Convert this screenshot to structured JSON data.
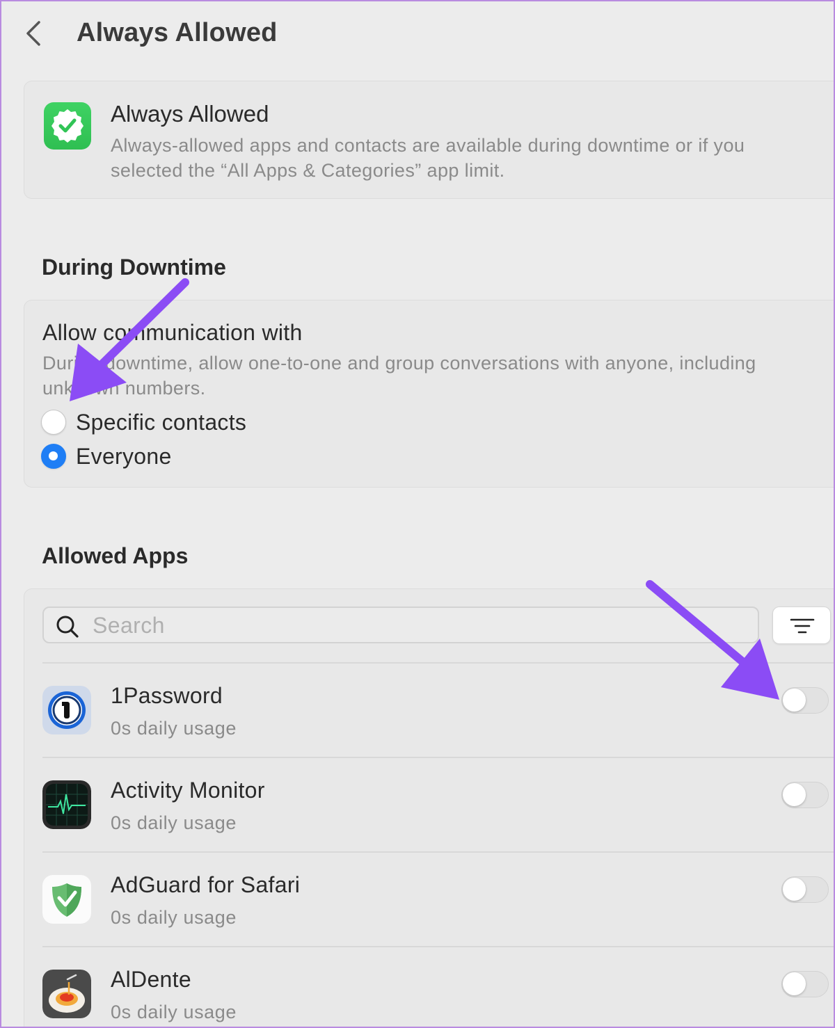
{
  "header": {
    "title": "Always Allowed",
    "back_icon": "chevron-left-icon"
  },
  "info": {
    "icon": "checkmark-seal-icon",
    "title": "Always Allowed",
    "description": "Always-allowed apps and contacts are available during downtime or if you selected the “All Apps & Categories” app limit."
  },
  "downtime": {
    "section_title": "During Downtime",
    "title": "Allow communication with",
    "description": "During downtime, allow one-to-one and group conversations with anyone, including unknown numbers.",
    "options": [
      {
        "label": "Specific contacts",
        "checked": false
      },
      {
        "label": "Everyone",
        "checked": true
      }
    ]
  },
  "apps": {
    "section_title": "Allowed Apps",
    "search_placeholder": "Search",
    "filter_icon": "filter-lines-icon",
    "items": [
      {
        "name": "1Password",
        "usage": "0s daily usage",
        "enabled": false,
        "icon": "1password-icon"
      },
      {
        "name": "Activity Monitor",
        "usage": "0s daily usage",
        "enabled": false,
        "icon": "activity-monitor-icon"
      },
      {
        "name": "AdGuard for Safari",
        "usage": "0s daily usage",
        "enabled": false,
        "icon": "adguard-shield-icon"
      },
      {
        "name": "AlDente",
        "usage": "0s daily usage",
        "enabled": false,
        "icon": "aldente-pasta-icon"
      }
    ]
  },
  "colors": {
    "accent": "#1f7ef5",
    "annotation": "#8b4cf5",
    "background": "#ececec"
  }
}
